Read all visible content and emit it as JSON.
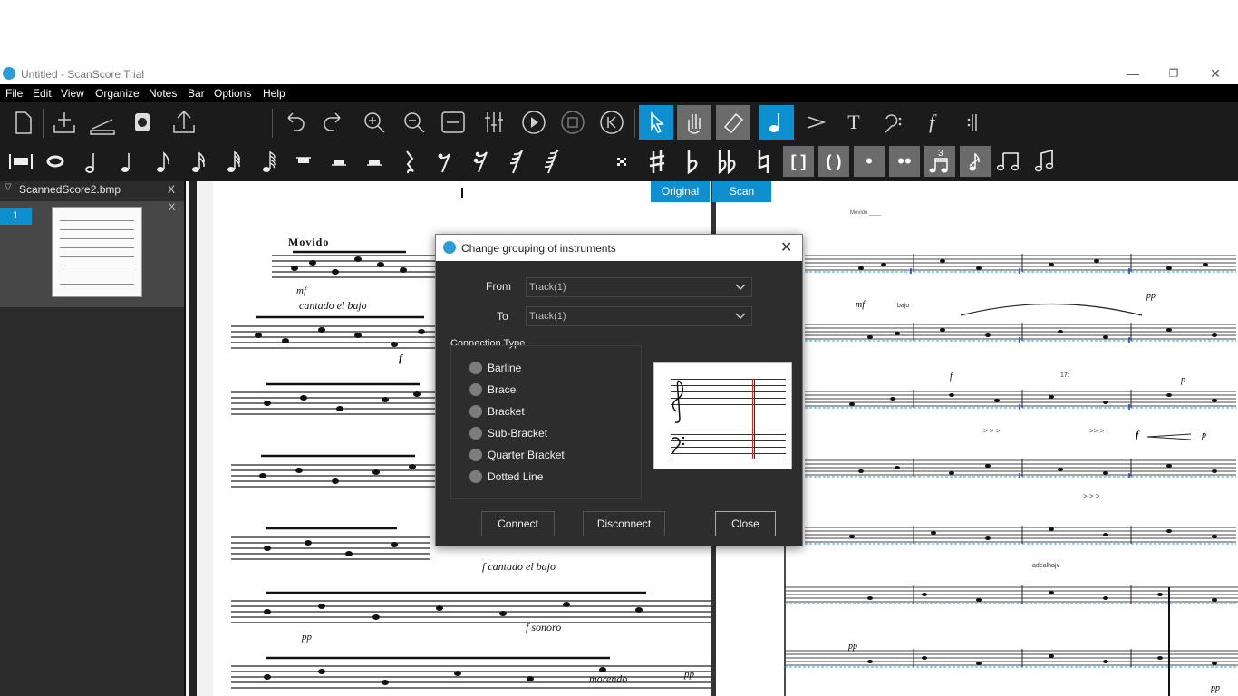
{
  "window": {
    "title": "Untitled - ScanScore Trial",
    "minimize": "—",
    "restore": "❐",
    "close": "✕"
  },
  "menu": [
    "File",
    "Edit",
    "View",
    "Organize",
    "Notes",
    "Bar",
    "Options",
    "Help"
  ],
  "toolbar_icons": [
    "new-file-icon",
    "import-icon",
    "scanner-icon",
    "help-icon",
    "export-icon",
    "undo-icon",
    "redo-icon",
    "zoom-in-icon",
    "zoom-out-icon",
    "fit-page-icon",
    "mixer-icon",
    "play-icon",
    "stop-icon",
    "rewind-icon",
    "select-icon",
    "pan-icon",
    "eraser-icon",
    "note-tool-icon",
    "accent-tool-icon",
    "text-tool-icon",
    "clef-tool-icon",
    "dynamics-tool-icon",
    "barline-tool-icon"
  ],
  "note_palette_icons": [
    "multimeasure-rest-icon",
    "whole-note-icon",
    "half-note-icon",
    "quarter-note-icon",
    "eighth-note-icon",
    "sixteenth-note-icon",
    "thirtysecond-note-icon",
    "sixtyfourth-note-icon",
    "whole-rest-icon",
    "half-rest-icon",
    "quarter-rest-icon-a",
    "quarter-rest-icon",
    "eighth-rest-icon",
    "sixteenth-rest-icon",
    "thirtysecond-rest-icon",
    "sixtyfourth-rest-icon",
    "grace-icon",
    "sharp-icon",
    "flat-icon",
    "double-flat-icon",
    "natural-icon",
    "bracket-accidental-icon",
    "paren-accidental-icon",
    "dot-icon",
    "double-dot-icon",
    "triplet-icon",
    "grace-note-icon",
    "tie-icon",
    "slur-icon"
  ],
  "tool_text": {
    "text_tool": "T",
    "dynamics_tool": "f",
    "bracket": "[ ]",
    "paren": "( )",
    "dot": "•",
    "double_dot": "••",
    "triplet": "3"
  },
  "sidebar": {
    "file_name": "ScannedScore2.bmp",
    "close": "X",
    "page_number": "1",
    "page_close": "X"
  },
  "view_tabs": {
    "original": "Original",
    "scan": "Scan"
  },
  "scan_text": {
    "tempo": "Movido",
    "dyn1": "mf",
    "cantado": "cantado el bajo",
    "ff": "f",
    "cantado2": "f cantado el bajo",
    "pp": "pp",
    "sonoro": "f sonoro",
    "morendo": "morendo",
    "pp2": "pp"
  },
  "render_text": {
    "tempo": "Movido ____",
    "mf": "mf",
    "bajo": "bajo",
    "pp": "pp",
    "f1": "f",
    "f2": "f",
    "p": "p",
    "bar17": "17:",
    "adealhajv": "adealhajv",
    "pp2": "pp",
    "pp3": "pp",
    "accents1": "> > >",
    "accents2": "> > >",
    "accents3": ">>  >"
  },
  "dialog": {
    "title": "Change grouping of instruments",
    "close_glyph": "✕",
    "from_label": "From",
    "from_value": "Track(1)",
    "to_label": "To",
    "to_value": "Track(1)",
    "connection_type_label": "Connection Type",
    "options": [
      "Barline",
      "Brace",
      "Bracket",
      "Sub-Bracket",
      "Quarter Bracket",
      "Dotted Line"
    ],
    "connect": "Connect",
    "disconnect": "Disconnect",
    "close": "Close"
  },
  "colors": {
    "accent": "#0e8fd0",
    "toolbar_bg": "#1b1b1b",
    "panel_bg": "#2b2b2b",
    "dialog_bg": "#2d2d2d"
  }
}
